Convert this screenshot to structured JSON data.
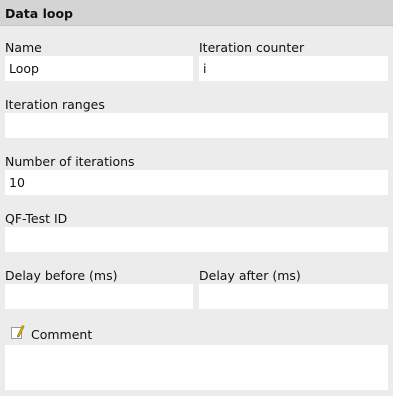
{
  "panel": {
    "title": "Data loop"
  },
  "fields": {
    "name": {
      "label": "Name",
      "value": "Loop"
    },
    "iteration_counter": {
      "label": "Iteration counter",
      "value": "i"
    },
    "iteration_ranges": {
      "label": "Iteration ranges",
      "value": ""
    },
    "number_of_iterations": {
      "label": "Number of iterations",
      "value": "10"
    },
    "qftest_id": {
      "label": "QF-Test ID",
      "value": ""
    },
    "delay_before": {
      "label": "Delay before (ms)",
      "value": ""
    },
    "delay_after": {
      "label": "Delay after (ms)",
      "value": ""
    },
    "comment": {
      "label": "Comment",
      "value": ""
    }
  },
  "icons": {
    "comment": "pencil-note-icon"
  },
  "colors": {
    "background": "#ececec",
    "titlebar": "#d4d4d4",
    "field": "#ffffff",
    "pencil": "#e6b800"
  }
}
